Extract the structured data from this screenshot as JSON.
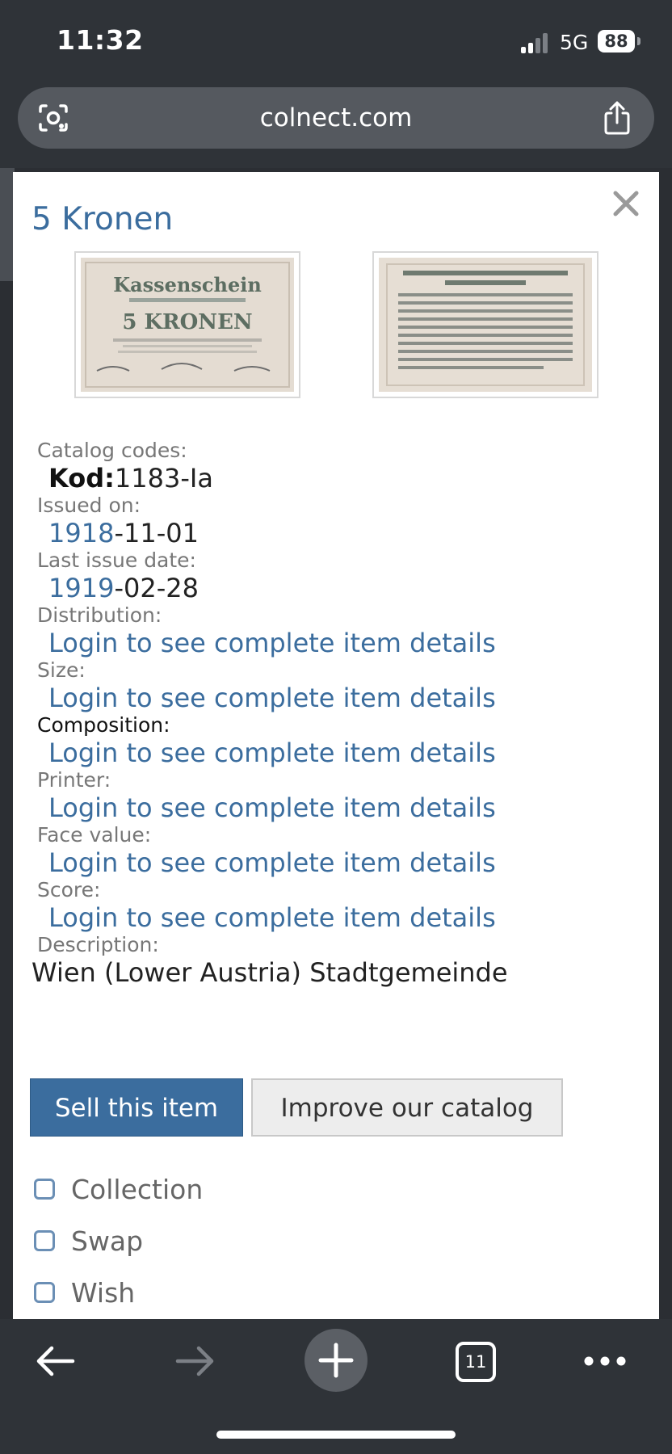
{
  "status_bar": {
    "time": "11:32",
    "network": "5G",
    "battery": "88"
  },
  "browser": {
    "url": "colnect.com",
    "tab_count": "11"
  },
  "item": {
    "title": "5 Kronen",
    "fields": [
      {
        "label": "Catalog codes:",
        "prefix": "Kod:",
        "value": "1183-Ia"
      },
      {
        "label": "Issued on:",
        "year": "1918",
        "rest": "-11-01"
      },
      {
        "label": "Last issue date:",
        "year": "1919",
        "rest": "-02-28"
      },
      {
        "label": "Distribution:",
        "value": "Login to see complete item details"
      },
      {
        "label": "Size:",
        "value": "Login to see complete item details"
      },
      {
        "label": "Composition:",
        "value": "Login to see complete item details"
      },
      {
        "label": "Printer:",
        "value": "Login to see complete item details"
      },
      {
        "label": "Face value:",
        "value": "Login to see complete item details"
      },
      {
        "label": "Score:",
        "value": "Login to see complete item details"
      },
      {
        "label": "Description:",
        "value": "Wien (Lower Austria) Stadtgemeinde"
      }
    ],
    "front_note": {
      "heading": "Kassenschein",
      "denomination": "5 KRONEN"
    }
  },
  "actions": {
    "sell": "Sell this item",
    "improve": "Improve our catalog"
  },
  "lists": [
    {
      "label": "Collection",
      "checked": false
    },
    {
      "label": "Swap",
      "checked": false
    },
    {
      "label": "Wish",
      "checked": false
    }
  ],
  "colors": {
    "link": "#3b6d9e",
    "chrome": "#2f3338",
    "sell_button": "#3b6d9e"
  }
}
